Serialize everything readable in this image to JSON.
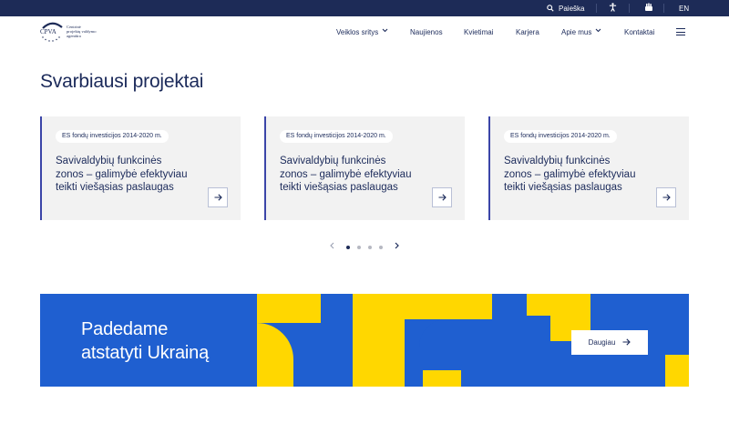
{
  "topbar": {
    "search_label": "Paieška",
    "accessibility_icon": "accessibility-icon",
    "sign_language_icon": "sign-language-icon",
    "language": "EN"
  },
  "logo": {
    "abbr": "CPVA",
    "line1": "Centrinė",
    "line2": "projektų valdymo",
    "line3": "agentūra"
  },
  "nav": {
    "items": [
      {
        "label": "Veiklos sritys",
        "dropdown": true
      },
      {
        "label": "Naujienos",
        "dropdown": false
      },
      {
        "label": "Kvietimai",
        "dropdown": false
      },
      {
        "label": "Karjera",
        "dropdown": false
      },
      {
        "label": "Apie mus",
        "dropdown": true
      },
      {
        "label": "Kontaktai",
        "dropdown": false
      }
    ],
    "menu_icon": "hamburger-menu-icon"
  },
  "main": {
    "title": "Svarbiausi projektai",
    "cards": [
      {
        "tag": "ES fondų investicijos 2014-2020 m.",
        "title": "Savivaldybių funkcinės zonos – galimybė efektyviau teikti viešąsias paslaugas"
      },
      {
        "tag": "ES fondų investicijos 2014-2020 m.",
        "title": "Savivaldybių funkcinės zonos – galimybė efektyviau teikti viešąsias paslaugas"
      },
      {
        "tag": "ES fondų investicijos 2014-2020 m.",
        "title": "Savivaldybių funkcinės zonos – galimybė efektyviau teikti viešąsias paslaugas"
      }
    ],
    "pager": {
      "total": 4,
      "active": 1
    }
  },
  "banner": {
    "heading_line1": "Padedame",
    "heading_line2": "atstatyti Ukrainą",
    "button_label": "Daugiau",
    "colors": {
      "blue": "#1f5fd0",
      "yellow": "#ffd700"
    }
  },
  "colors": {
    "navy": "#1d2b57",
    "accent": "#3b45a8",
    "card_bg": "#f2f2f2"
  }
}
